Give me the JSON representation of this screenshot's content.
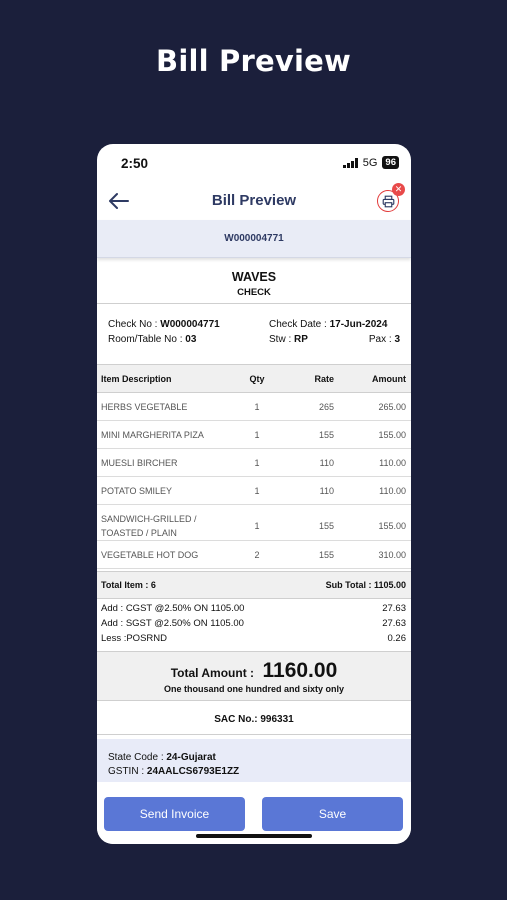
{
  "promo": {
    "headline": "Bill Preview"
  },
  "status": {
    "time": "2:50",
    "network": "5G",
    "battery": "96"
  },
  "appbar": {
    "title": "Bill Preview"
  },
  "check_no_banner": "W000004771",
  "bill": {
    "outlet": "WAVES",
    "doc_type": "CHECK",
    "check_no_label": "Check No :",
    "check_no": "W000004771",
    "check_date_label": "Check Date :",
    "check_date": "17-Jun-2024",
    "room_label": "Room/Table No :",
    "room": "03",
    "stw_label": "Stw :",
    "stw": "RP",
    "pax_label": "Pax :",
    "pax": "3",
    "headers": {
      "desc": "Item Description",
      "qty": "Qty",
      "rate": "Rate",
      "amount": "Amount"
    },
    "items": [
      {
        "desc": "HERBS VEGETABLE",
        "qty": "1",
        "rate": "265",
        "amount": "265.00"
      },
      {
        "desc": "MINI MARGHERITA PIZA",
        "qty": "1",
        "rate": "155",
        "amount": "155.00"
      },
      {
        "desc": "MUESLI BIRCHER",
        "qty": "1",
        "rate": "110",
        "amount": "110.00"
      },
      {
        "desc": "POTATO SMILEY",
        "qty": "1",
        "rate": "110",
        "amount": "110.00"
      },
      {
        "desc": "SANDWICH-GRILLED / TOASTED / PLAIN",
        "qty": "1",
        "rate": "155",
        "amount": "155.00"
      },
      {
        "desc": "VEGETABLE HOT DOG",
        "qty": "2",
        "rate": "155",
        "amount": "310.00"
      }
    ],
    "total_items_label": "Total Item : 6",
    "subtotal_label": "Sub Total : 1105.00",
    "taxes": [
      {
        "label": "Add : CGST @2.50% ON 1105.00",
        "amount": "27.63"
      },
      {
        "label": "Add : SGST @2.50% ON 1105.00",
        "amount": "27.63"
      },
      {
        "label": "Less :POSRND",
        "amount": "0.26"
      }
    ],
    "total_label": "Total Amount :",
    "total_value": "1160.00",
    "total_words": "One thousand one hundred and sixty only",
    "sac": "SAC No.: 996331",
    "state_label": "State Code :",
    "state": "24-Gujarat",
    "gstin_label": "GSTIN :",
    "gstin": "24AALCS6793E1ZZ"
  },
  "actions": {
    "send": "Send Invoice",
    "save": "Save"
  },
  "colors": {
    "background": "#1b1f3b",
    "accent": "#5a77d6",
    "title": "#2e3a63",
    "danger": "#e84a4a"
  },
  "icons": {
    "back": "arrow-left-icon",
    "print": "printer-icon",
    "close": "close-badge-icon"
  }
}
